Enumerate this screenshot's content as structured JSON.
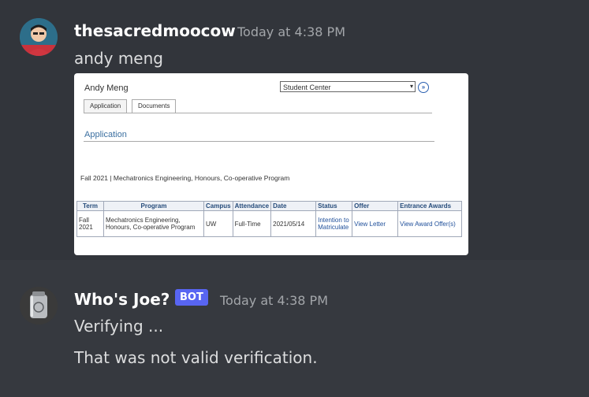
{
  "messages": [
    {
      "username": "thesacredmoocow",
      "timestamp": "Today at 4:38 PM",
      "text": "andy meng"
    },
    {
      "username": "Who's Joe?",
      "badge": "BOT",
      "timestamp": "Today at 4:38 PM",
      "lines": [
        "Verifying ...",
        "That was not valid verification."
      ]
    }
  ],
  "attachment": {
    "name": "Andy Meng",
    "select_value": "Student Center",
    "tabs": [
      "Application",
      "Documents"
    ],
    "section_title": "Application",
    "program_line": "Fall 2021 | Mechatronics Engineering, Honours, Co-operative Program",
    "table": {
      "headers": [
        "Term",
        "Program",
        "Campus",
        "Attendance",
        "Date",
        "Status",
        "Offer",
        "Entrance Awards"
      ],
      "row": {
        "term": "Fall 2021",
        "program": "Mechatronics Engineering, Honours, Co-operative Program",
        "campus": "UW",
        "attendance": "Full-Time",
        "date": "2021/05/14",
        "status": "Intention to Matriculate",
        "offer": "View Letter",
        "awards": "View Award Offer(s)"
      }
    }
  },
  "colors": {
    "background": "#36393f",
    "username": "#ffffff",
    "timestamp": "#a3a6aa",
    "bot_badge": "#5865f2",
    "link": "#1f4f9a"
  },
  "icons": {
    "user_avatar": "user-avatar-cartoon",
    "bot_avatar": "flask-avatar"
  }
}
